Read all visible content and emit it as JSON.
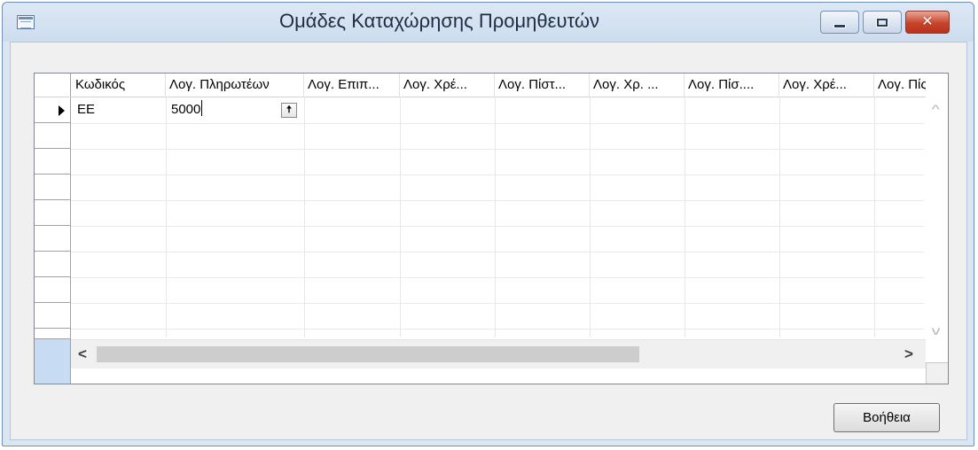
{
  "window": {
    "title": "Ομάδες Καταχώρησης Προμηθευτών",
    "icon": "table-icon",
    "controls": {
      "minimize": "minimize-icon",
      "maximize": "maximize-icon",
      "close": "✕"
    }
  },
  "grid": {
    "columns": [
      "Κωδικός",
      "Λογ. Πληρωτέων",
      "Λογ. Επιπ...",
      "Λογ. Χρέ...",
      "Λογ. Πίστ...",
      "Λογ. Χρ. ...",
      "Λογ. Πίσ....",
      "Λογ. Χρέ...",
      "Λογ. Πίς"
    ],
    "rows": [
      {
        "code": "EE",
        "payables_account": "5000"
      }
    ],
    "lookup_icon": "up-arrow-icon"
  },
  "scrollbar": {
    "left": "<",
    "right": ">",
    "up": "^",
    "down": "v"
  },
  "buttons": {
    "help": "Βοήθεια"
  }
}
